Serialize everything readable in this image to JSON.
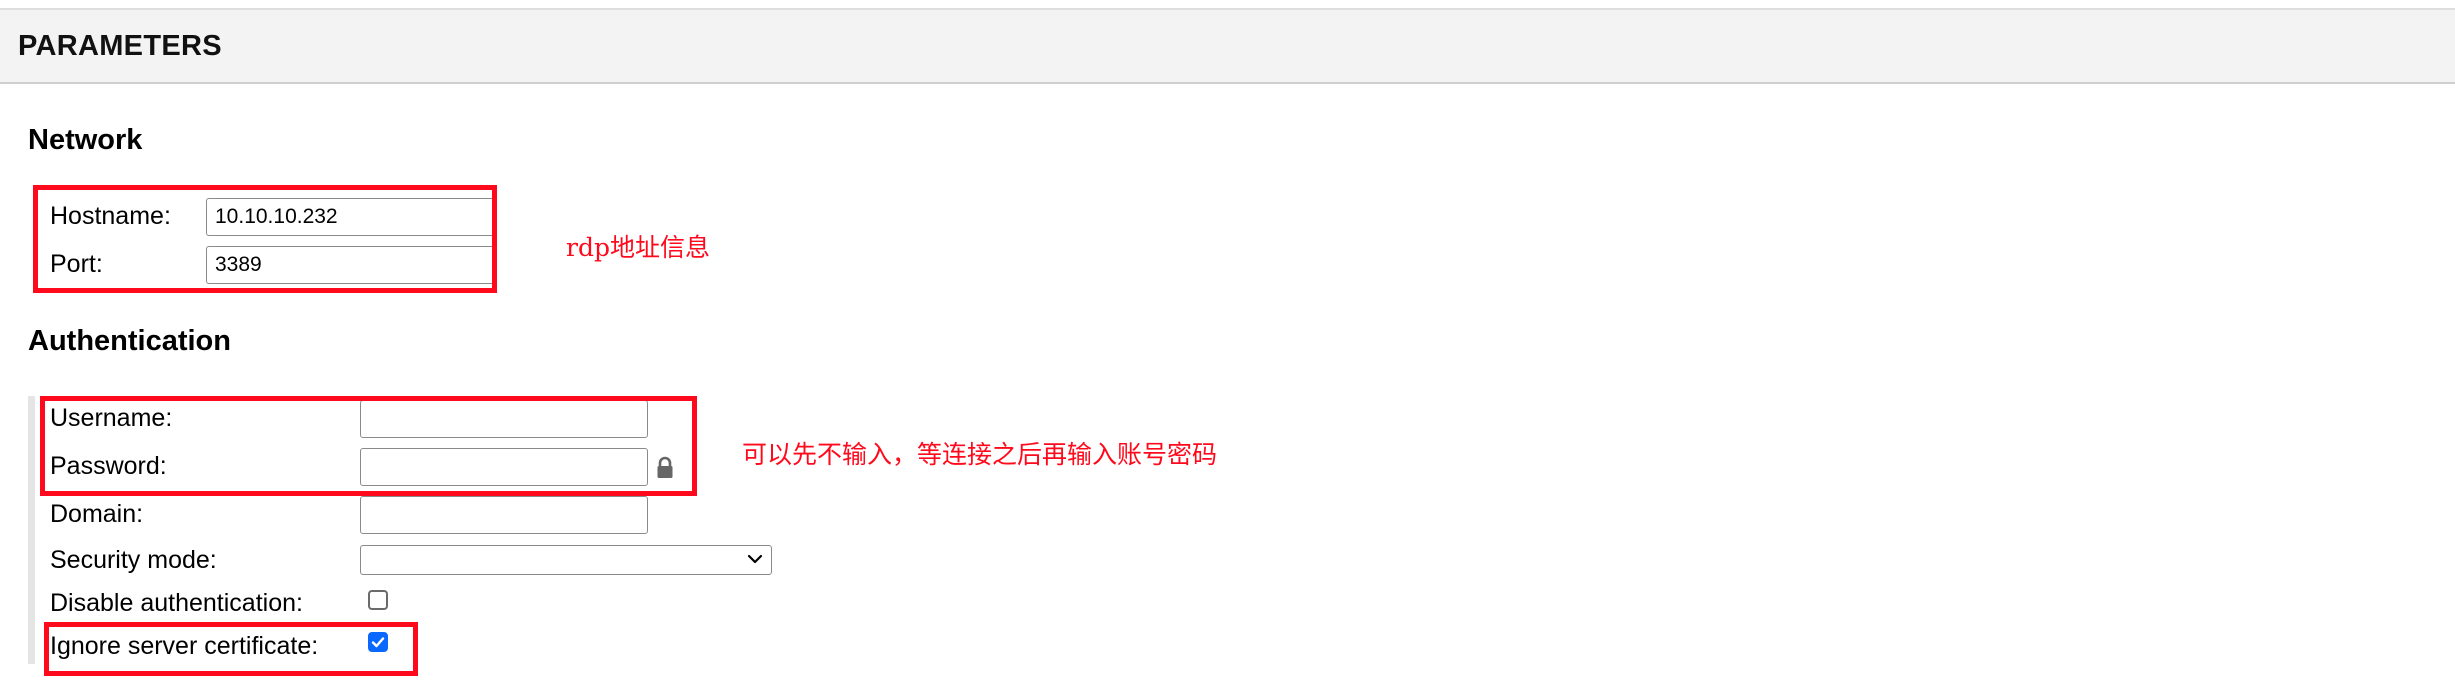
{
  "header": {
    "title": "PARAMETERS"
  },
  "network": {
    "heading": "Network",
    "hostname_label": "Hostname:",
    "hostname_value": "10.10.10.232",
    "port_label": "Port:",
    "port_value": "3389"
  },
  "authentication": {
    "heading": "Authentication",
    "username_label": "Username:",
    "username_value": "",
    "password_label": "Password:",
    "password_value": "",
    "domain_label": "Domain:",
    "domain_value": "",
    "security_mode_label": "Security mode:",
    "security_mode_value": "",
    "disable_auth_label": "Disable authentication:",
    "disable_auth_checked": false,
    "ignore_cert_label": "Ignore server certificate:",
    "ignore_cert_checked": true
  },
  "annotations": {
    "network_note": "rdp地址信息",
    "auth_note": "可以先不输入，等连接之后再输入账号密码",
    "color": "#ff0a1c"
  },
  "icons": {
    "password": "lock-icon",
    "security_mode": "chevron-down-icon",
    "checkbox_checked": "checkmark-icon"
  },
  "colors": {
    "header_bg": "#f3f3f3",
    "checkbox_accent": "#0a68ff",
    "annotation_red": "#ff0a1c"
  }
}
